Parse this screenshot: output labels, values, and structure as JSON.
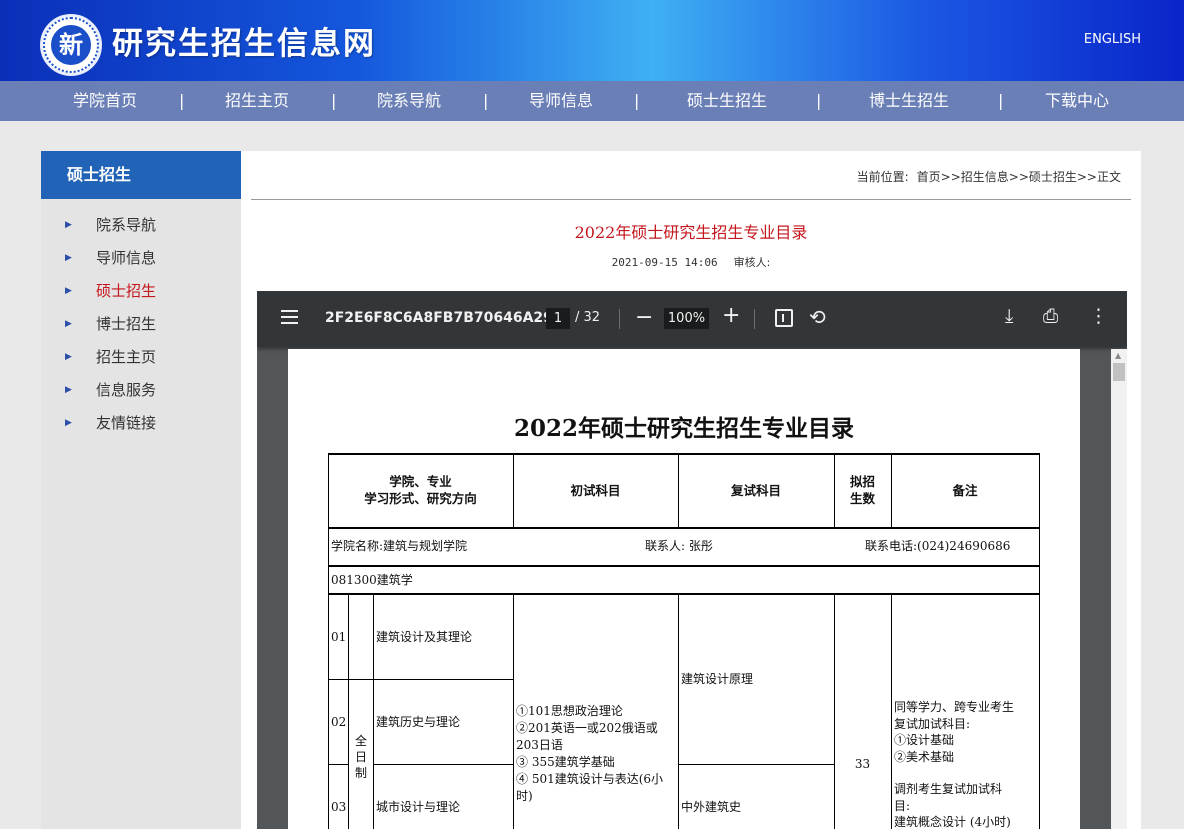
{
  "header": {
    "site_title": "研究生招生信息网",
    "lang_link": "ENGLISH",
    "logo_glyph": "新"
  },
  "nav": {
    "items": [
      "学院首页",
      "招生主页",
      "院系导航",
      "导师信息",
      "硕士生招生",
      "博士生招生",
      "下载中心"
    ],
    "separator": "|"
  },
  "sidebar": {
    "title": "硕士招生",
    "items": [
      "院系导航",
      "导师信息",
      "硕士招生",
      "博士招生",
      "招生主页",
      "信息服务",
      "友情链接"
    ],
    "active_index": 2
  },
  "breadcrumb": {
    "label": "当前位置:",
    "path": "首页>>招生信息>>硕士招生>>正文"
  },
  "article": {
    "title": "2022年硕士研究生招生专业目录",
    "date": "2021-09-15 14:06",
    "reviewer_label": "审核人:"
  },
  "pdf_viewer": {
    "file_name": "2F2E6F8C6A8FB7B70646A29...",
    "current_page": "1",
    "total_pages": "/ 32",
    "zoom": "100%",
    "icons": [
      "menu-icon",
      "zoom-out-icon",
      "zoom-in-icon",
      "fit-page-icon",
      "rotate-icon",
      "download-icon",
      "print-icon",
      "more-icon"
    ]
  },
  "document": {
    "title": "2022年硕士研究生招生专业目录",
    "headers": {
      "col1_line1": "学院、专业",
      "col1_line2": "学习形式、研究方向",
      "col2": "初试科目",
      "col3": "复试科目",
      "col4_line1": "拟招",
      "col4_line2": "生数",
      "col5": "备注"
    },
    "college": {
      "name": "学院名称:建筑与规划学院",
      "contact": "联系人: 张彤",
      "phone": "联系电话:(024)24690686"
    },
    "major": "081300建筑学",
    "study_mode": [
      "全",
      "日",
      "制"
    ],
    "directions": [
      {
        "code": "01",
        "name": "建筑设计及其理论"
      },
      {
        "code": "02",
        "name": "建筑历史与理论"
      },
      {
        "code": "03",
        "name": "城市设计与理论"
      }
    ],
    "exam_subjects": [
      "①101思想政治理论",
      "②201英语一或202俄语或",
      "203日语",
      "③ 355建筑学基础",
      "④ 501建筑设计与表达(6小",
      "时)"
    ],
    "retest_1": "建筑设计原理",
    "retest_2": "中外建筑史",
    "quota": "33",
    "notes": [
      "同等学力、跨专业考生",
      "复试加试科目:",
      "①设计基础",
      "②美术基础",
      "",
      "调剂考生复试加试科",
      "目:",
      "建筑概念设计 (4小时)"
    ]
  },
  "colors": {
    "header_blue": "#1457dd",
    "nav_bg": "#6a7fb6",
    "sidebar_head": "#2163b6",
    "accent_red": "#c4161c",
    "pdf_toolbar": "#323639"
  }
}
